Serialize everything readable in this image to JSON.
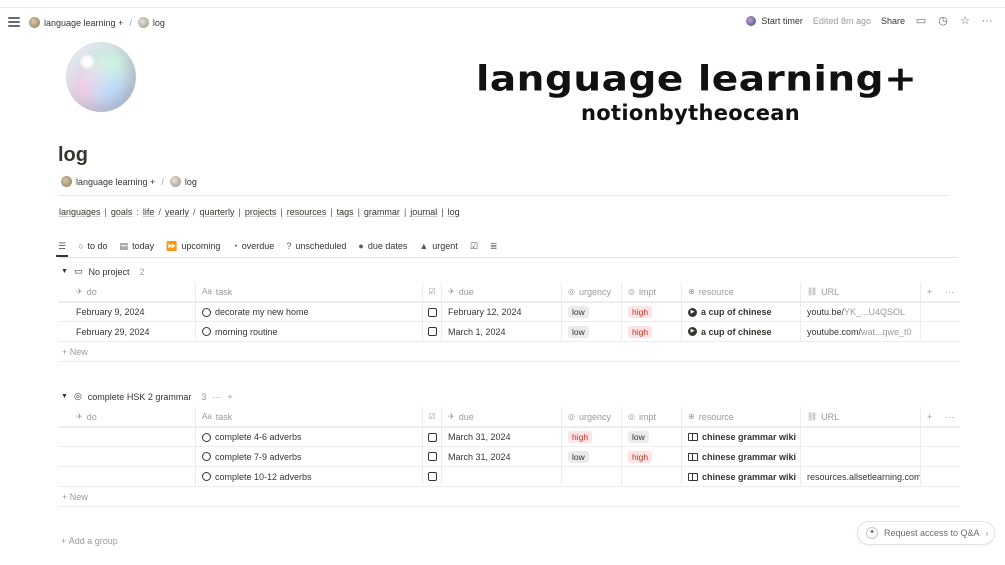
{
  "nav": {
    "breadcrumb": [
      "language learning +",
      "log"
    ],
    "start_timer": "Start timer",
    "edited": "Edited 8m ago",
    "share": "Share"
  },
  "banner": {
    "title": "language learning+",
    "subtitle": "notionbytheocean"
  },
  "page": {
    "title": "log",
    "breadcrumb": [
      "language learning +",
      "log"
    ]
  },
  "links": [
    "languages",
    "goals",
    "life",
    "yearly",
    "quarterly",
    "projects",
    "resources",
    "tags",
    "grammar",
    "journal",
    "log"
  ],
  "views": [
    "to do",
    "today",
    "upcoming",
    "overdue",
    "unscheduled",
    "due dates",
    "urgent"
  ],
  "columns": {
    "do": "do",
    "task": "task",
    "due": "due",
    "urgency": "urgency",
    "impt": "impt",
    "resource": "resource",
    "url": "URL"
  },
  "groups": [
    {
      "name": "No project",
      "count": "2",
      "rows": [
        {
          "do": "February 9, 2024",
          "task": "decorate my new home",
          "due": "February 12, 2024",
          "urgency": "low",
          "impt": "high",
          "resource": "a cup of chinese",
          "url_main": "youtu.be/",
          "url_dim": "YK_...U4QSOL"
        },
        {
          "do": "February 29, 2024",
          "task": "morning routine",
          "due": "March 1, 2024",
          "urgency": "low",
          "impt": "high",
          "resource": "a cup of chinese",
          "url_main": "youtube.com/",
          "url_dim": "wat...qwe_t0"
        }
      ]
    },
    {
      "name": "complete HSK 2 grammar",
      "count": "3",
      "rows": [
        {
          "do": "",
          "task": "complete 4-6 adverbs",
          "due": "March 31, 2024",
          "urgency": "high",
          "impt": "low",
          "resource": "chinese grammar wiki",
          "url_main": "",
          "url_dim": ""
        },
        {
          "do": "",
          "task": "complete 7-9 adverbs",
          "due": "March 31, 2024",
          "urgency": "low",
          "impt": "high",
          "resource": "chinese grammar wiki",
          "url_main": "",
          "url_dim": ""
        },
        {
          "do": "",
          "task": "complete 10-12 adverbs",
          "due": "",
          "urgency": "",
          "impt": "",
          "resource": "chinese grammar wiki",
          "url_main": "resources.allsetlearning.com/",
          "url_dim": ""
        }
      ]
    }
  ],
  "new_label": "New",
  "add_group": "Add a group",
  "qa_label": "Request access to Q&A"
}
